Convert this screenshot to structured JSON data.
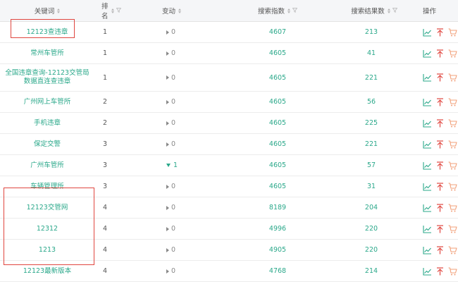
{
  "columns": {
    "keyword": "关键词",
    "rank": "排名",
    "change": "变动",
    "search_index": "搜索指数",
    "result_count": "搜索结果数",
    "actions": "操作"
  },
  "rows": [
    {
      "keyword": "12123查违章",
      "rank": "1",
      "change": "0",
      "change_dir": "none",
      "search_index": "4607",
      "result_count": "213"
    },
    {
      "keyword": "常州车管所",
      "rank": "1",
      "change": "0",
      "change_dir": "none",
      "search_index": "4605",
      "result_count": "41"
    },
    {
      "keyword": "全国违章查询-12123交管局数据直连查违章",
      "rank": "1",
      "change": "0",
      "change_dir": "none",
      "search_index": "4605",
      "result_count": "221"
    },
    {
      "keyword": "广州网上车管所",
      "rank": "2",
      "change": "0",
      "change_dir": "none",
      "search_index": "4605",
      "result_count": "56"
    },
    {
      "keyword": "手机违章",
      "rank": "2",
      "change": "0",
      "change_dir": "none",
      "search_index": "4605",
      "result_count": "225"
    },
    {
      "keyword": "保定交警",
      "rank": "3",
      "change": "0",
      "change_dir": "none",
      "search_index": "4605",
      "result_count": "221"
    },
    {
      "keyword": "广州车管所",
      "rank": "3",
      "change": "1",
      "change_dir": "up",
      "search_index": "4605",
      "result_count": "57"
    },
    {
      "keyword": "车辆管理所",
      "rank": "3",
      "change": "0",
      "change_dir": "none",
      "search_index": "4605",
      "result_count": "31"
    },
    {
      "keyword": "12123交管网",
      "rank": "4",
      "change": "0",
      "change_dir": "none",
      "search_index": "8189",
      "result_count": "204"
    },
    {
      "keyword": "12312",
      "rank": "4",
      "change": "0",
      "change_dir": "none",
      "search_index": "4996",
      "result_count": "220"
    },
    {
      "keyword": "1213",
      "rank": "4",
      "change": "0",
      "change_dir": "none",
      "search_index": "4905",
      "result_count": "220"
    },
    {
      "keyword": "12123最新版本",
      "rank": "4",
      "change": "0",
      "change_dir": "none",
      "search_index": "4768",
      "result_count": "214"
    }
  ],
  "actions": {
    "icons": [
      "trend-chart-icon",
      "pin-to-top-icon",
      "cart-icon"
    ]
  },
  "colors": {
    "accent_green": "#2aa88a",
    "action_orange": "#f2a07a",
    "highlight_red": "#e0463f",
    "header_bg": "#f5f6f8"
  }
}
